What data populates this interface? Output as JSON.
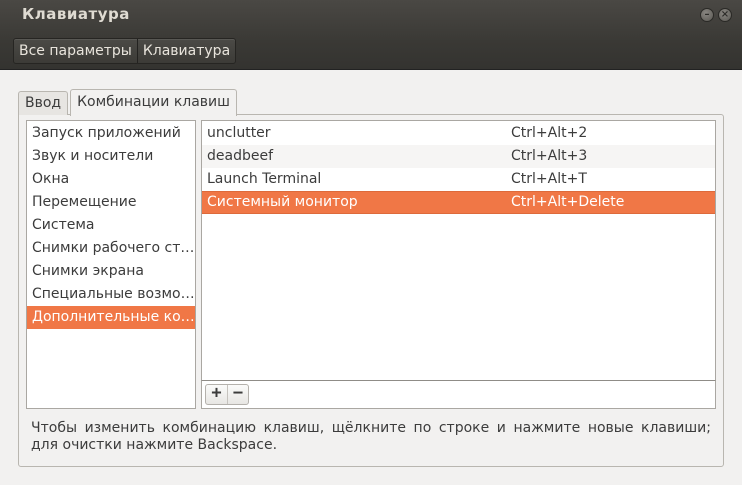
{
  "window": {
    "title": "Клавиатура"
  },
  "breadcrumb": {
    "items": [
      "Все параметры",
      "Клавиатура"
    ]
  },
  "tabs": [
    {
      "label": "Ввод"
    },
    {
      "label": "Комбинации клавиш",
      "active": true
    }
  ],
  "sections": {
    "items": [
      "Запуск приложений",
      "Звук и носители",
      "Окна",
      "Перемещение",
      "Система",
      "Снимки рабочего ст…",
      "Снимки экрана",
      "Специальные возмо…",
      "Дополнительные ко…"
    ],
    "selected_index": 8
  },
  "shortcuts": {
    "rows": [
      {
        "name": "unclutter",
        "accel": "Ctrl+Alt+2"
      },
      {
        "name": "deadbeef",
        "accel": "Ctrl+Alt+3"
      },
      {
        "name": "Launch Terminal",
        "accel": "Ctrl+Alt+T"
      },
      {
        "name": "Системный монитор",
        "accel": "Ctrl+Alt+Delete"
      }
    ],
    "selected_index": 3
  },
  "toolbar": {
    "add_label": "+",
    "remove_label": "−"
  },
  "hint": {
    "text": "Чтобы изменить комбинацию клавиш, щёлкните по строке и нажмите новые клавиши; для очистки нажмите Backspace."
  },
  "colors": {
    "selection": "#f07746",
    "titlebar": "#3c3b37"
  },
  "icons": {
    "minimize": "minimize-icon",
    "close": "close-icon"
  }
}
